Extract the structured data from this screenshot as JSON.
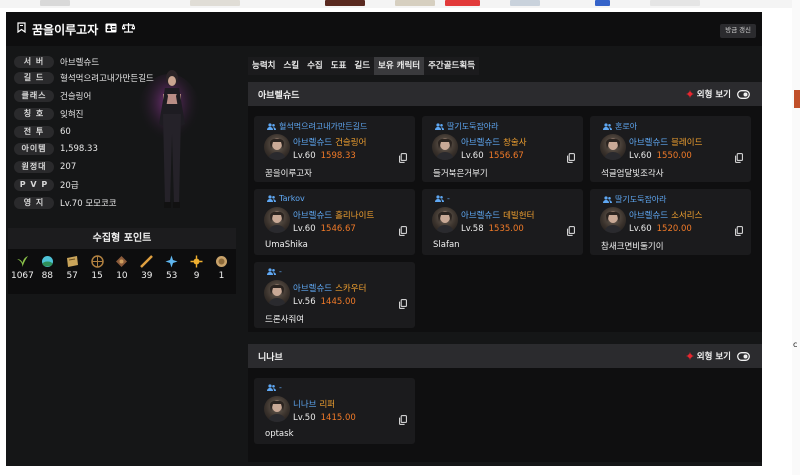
{
  "header": {
    "title": "꿈을이루고자",
    "refresh_label": "방금 갱신"
  },
  "profile": {
    "rows": [
      {
        "label": "서 버",
        "value": "아브렐슈드"
      },
      {
        "label": "길 드",
        "value": "혈석먹으려고내가만든길드"
      },
      {
        "label": "클래스",
        "value": "건슬링어"
      },
      {
        "label": "칭 호",
        "value": "잊혀진"
      },
      {
        "label": "전 투",
        "value": "60"
      },
      {
        "label": "아이템",
        "value": "1,598.33"
      },
      {
        "label": "원정대",
        "value": "207"
      },
      {
        "label": "P V P",
        "value": "20급"
      },
      {
        "label": "영 지",
        "value": "Lv.70 모모코코"
      }
    ]
  },
  "collect": {
    "title": "수집형 포인트",
    "items": [
      {
        "icon": "island-heart-icon",
        "value": "1067"
      },
      {
        "icon": "orb-icon",
        "value": "88"
      },
      {
        "icon": "artwork-icon",
        "value": "57"
      },
      {
        "icon": "voyage-icon",
        "value": "15"
      },
      {
        "icon": "mokoko-seed-icon",
        "value": "10"
      },
      {
        "icon": "world-tree-leaf-icon",
        "value": "39"
      },
      {
        "icon": "ignea-token-icon",
        "value": "53"
      },
      {
        "icon": "orpheus-star-icon",
        "value": "9"
      },
      {
        "icon": "giant-heart-icon",
        "value": "1"
      }
    ]
  },
  "tabs": [
    "능력치",
    "스킬",
    "수집",
    "도표",
    "길드",
    "보유 캐릭터",
    "주간골드획득"
  ],
  "active_tab": "보유 캐릭터",
  "view_toggle_label": "외형 보기",
  "sections": [
    {
      "server": "아브렐슈드",
      "characters": [
        {
          "guild": "혈석먹으려고내가만든길드",
          "server": "아브렐슈드",
          "class": "건슬링어",
          "level": "Lv.60",
          "item_level": "1598.33",
          "name": "꿈을이루고자"
        },
        {
          "guild": "딸기도둑잡아라",
          "server": "아브렐슈드",
          "class": "창술사",
          "level": "Lv.60",
          "item_level": "1556.67",
          "name": "들거북은거부기"
        },
        {
          "guild": "혼로아",
          "server": "아브렐슈드",
          "class": "블레이드",
          "level": "Lv.60",
          "item_level": "1550.00",
          "name": "석글엄달빛조각사"
        },
        {
          "guild": "Tarkov",
          "server": "아브렐슈드",
          "class": "홀리나이트",
          "level": "Lv.60",
          "item_level": "1546.67",
          "name": "UmaShika"
        },
        {
          "guild": "-",
          "server": "아브렐슈드",
          "class": "데빌헌터",
          "level": "Lv.58",
          "item_level": "1535.00",
          "name": "Slafan"
        },
        {
          "guild": "딸기도둑잡아라",
          "server": "아브렐슈드",
          "class": "소서리스",
          "level": "Lv.60",
          "item_level": "1520.00",
          "name": "참새크면비둘기이"
        },
        {
          "guild": "-",
          "server": "아브렐슈드",
          "class": "스카우터",
          "level": "Lv.56",
          "item_level": "1445.00",
          "name": "드론사줘여"
        }
      ]
    },
    {
      "server": "니나브",
      "characters": [
        {
          "guild": "-",
          "server": "니나브",
          "class": "리퍼",
          "level": "Lv.50",
          "item_level": "1415.00",
          "name": "optask"
        }
      ]
    }
  ],
  "colors": {
    "guild_blue": "#5fa8f4",
    "class_orange": "#f0a030",
    "item_level_orange": "#f07a28",
    "toggle_red": "#e8262f"
  }
}
